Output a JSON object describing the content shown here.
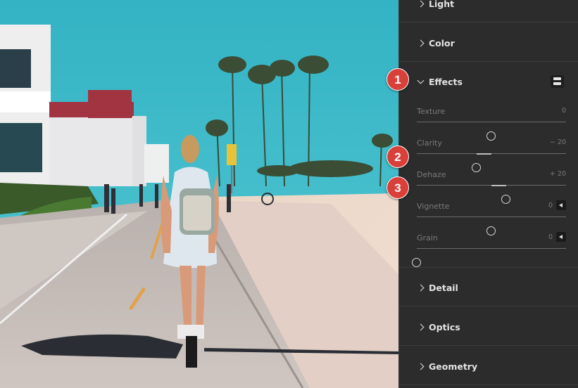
{
  "panel": {
    "sections_top": [
      {
        "label": "Light",
        "expanded": false
      },
      {
        "label": "Color",
        "expanded": false
      }
    ],
    "effects": {
      "label": "Effects",
      "expanded": true,
      "mask_icon": "mask-toggle-icon",
      "sliders": [
        {
          "name": "Texture",
          "value": "0",
          "min": -100,
          "max": 100,
          "current": 0
        },
        {
          "name": "Clarity",
          "value": "− 20",
          "min": -100,
          "max": 100,
          "current": -20
        },
        {
          "name": "Dehaze",
          "value": "+ 20",
          "min": -100,
          "max": 100,
          "current": 20
        },
        {
          "name": "Vignette",
          "value": "0",
          "min": -100,
          "max": 100,
          "current": 0,
          "has_arrow": true
        },
        {
          "name": "Grain",
          "value": "0",
          "min": 0,
          "max": 100,
          "current": 0,
          "has_arrow": true
        }
      ]
    },
    "sections_bottom": [
      {
        "label": "Detail",
        "expanded": false
      },
      {
        "label": "Optics",
        "expanded": false
      },
      {
        "label": "Geometry",
        "expanded": false
      }
    ]
  },
  "callouts": [
    "1",
    "2",
    "3"
  ],
  "colors": {
    "panel_bg": "#2c2c2c",
    "callout_red": "#d9403a",
    "sky": "#3fb8c8"
  }
}
